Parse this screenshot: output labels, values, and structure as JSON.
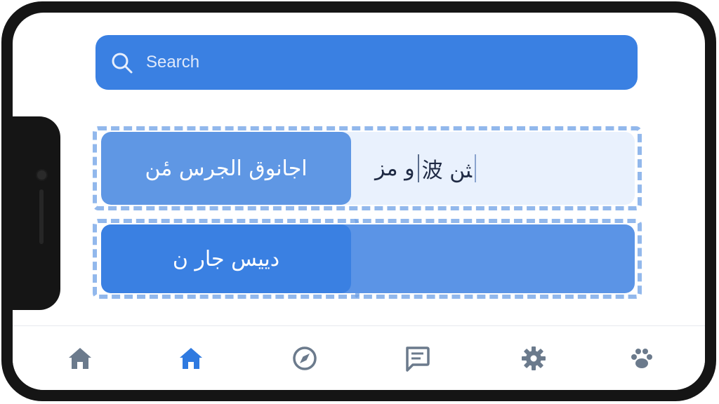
{
  "search": {
    "placeholder": "Search"
  },
  "rows": [
    {
      "label": "اجانوق الجرس مٔن",
      "field_before_caret": "و مز",
      "field_after_caret": "波 ﺜﻦ"
    },
    {
      "label": "ﺩﻳﻴﺲ ﺟﺎﺭ ﻥ"
    }
  ],
  "bottom_nav": {
    "items": [
      {
        "icon": "home-icon",
        "active": false
      },
      {
        "icon": "home-icon",
        "active": true
      },
      {
        "icon": "compass-icon",
        "active": false
      },
      {
        "icon": "chat-icon",
        "active": false
      },
      {
        "icon": "gear-icon",
        "active": false
      },
      {
        "icon": "paw-icon",
        "active": false
      }
    ]
  },
  "colors": {
    "accent": "#3a80e2",
    "accent_light": "#5f97e4",
    "field_bg": "#e9f1fd",
    "nav_inactive": "#6b7a8c",
    "nav_active": "#2f7ae0"
  }
}
